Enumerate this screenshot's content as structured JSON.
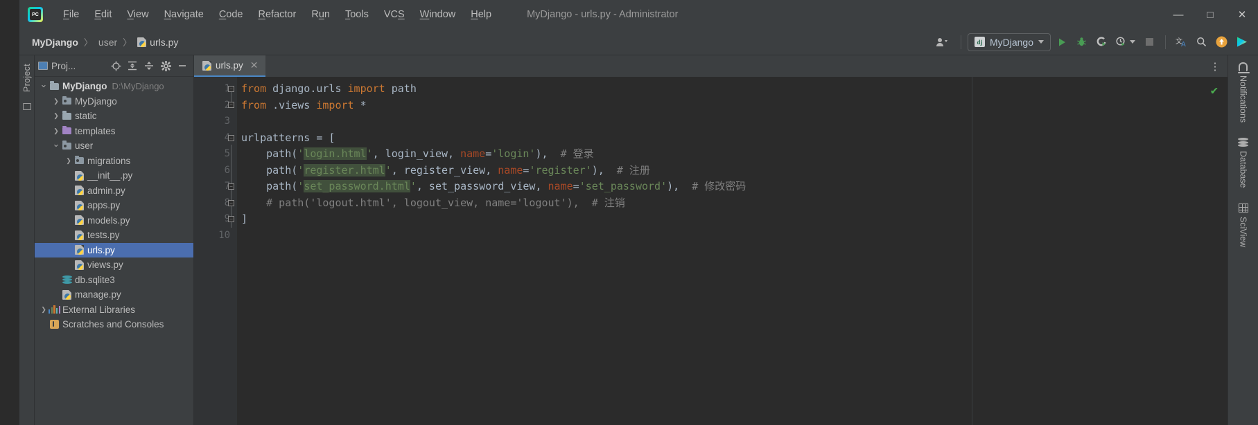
{
  "window": {
    "title": "MyDjango - urls.py - Administrator",
    "app_icon": "pycharm-logo-icon",
    "controls": {
      "minimize": "—",
      "maximize": "□",
      "close": "✕"
    }
  },
  "menubar": {
    "items": [
      {
        "label": "File",
        "mnemonic": "F"
      },
      {
        "label": "Edit",
        "mnemonic": "E"
      },
      {
        "label": "View",
        "mnemonic": "V"
      },
      {
        "label": "Navigate",
        "mnemonic": "N"
      },
      {
        "label": "Code",
        "mnemonic": "C"
      },
      {
        "label": "Refactor",
        "mnemonic": "R"
      },
      {
        "label": "Run",
        "mnemonic": "u"
      },
      {
        "label": "Tools",
        "mnemonic": "T"
      },
      {
        "label": "VCS",
        "mnemonic": "S"
      },
      {
        "label": "Window",
        "mnemonic": "W"
      },
      {
        "label": "Help",
        "mnemonic": "H"
      }
    ]
  },
  "navbar": {
    "breadcrumbs": [
      {
        "label": "MyDjango",
        "icon": ""
      },
      {
        "label": "user",
        "icon": ""
      },
      {
        "label": "urls.py",
        "icon": "python-file-icon"
      }
    ],
    "separator": "〉",
    "account_icon": "user-account-icon",
    "run_config": {
      "label": "MyDjango",
      "icon": "django-icon"
    },
    "actions": [
      {
        "name": "run-button",
        "icon": "play-icon",
        "color": "#499c54"
      },
      {
        "name": "debug-button",
        "icon": "bug-icon",
        "color": "#499c54"
      },
      {
        "name": "run-coverage-button",
        "icon": "coverage-icon",
        "color": "#b0b0b0"
      },
      {
        "name": "profile-button",
        "icon": "profile-icon",
        "color": "#b0b0b0"
      },
      {
        "name": "stop-button",
        "icon": "stop-square-icon",
        "color": "#6e6e6e"
      },
      {
        "name": "translate-button",
        "icon": "translate-icon",
        "color": "#b0b0b0"
      },
      {
        "name": "search-everywhere-button",
        "icon": "search-icon",
        "color": "#b0b0b0"
      },
      {
        "name": "update-button",
        "icon": "update-arrow-icon",
        "color": "#e8a33d"
      },
      {
        "name": "ide-assistant-button",
        "icon": "colorful-play-icon",
        "color": "#4a88c7"
      }
    ]
  },
  "left_strip": {
    "label": "Project",
    "structure_label": ""
  },
  "project_panel": {
    "title": "Proj...",
    "header_buttons": [
      {
        "name": "select-opened-file-button",
        "icon": "locate-target-icon"
      },
      {
        "name": "expand-all-button",
        "icon": "expand-all-icon"
      },
      {
        "name": "collapse-all-button",
        "icon": "collapse-all-icon"
      },
      {
        "name": "settings-button",
        "icon": "gear-icon"
      },
      {
        "name": "hide-button",
        "icon": "minimize-icon"
      }
    ],
    "tree": [
      {
        "label": "MyDjango",
        "path": "D:\\MyDjango",
        "icon": "folder-icon",
        "indent": 0,
        "arrow": "down",
        "bold": true,
        "selected": false
      },
      {
        "label": "MyDjango",
        "path": "",
        "icon": "source-folder-icon",
        "indent": 1,
        "arrow": "right",
        "bold": false,
        "selected": false
      },
      {
        "label": "static",
        "path": "",
        "icon": "folder-icon",
        "indent": 1,
        "arrow": "right",
        "bold": false,
        "selected": false
      },
      {
        "label": "templates",
        "path": "",
        "icon": "templates-folder-icon",
        "indent": 1,
        "arrow": "right",
        "bold": false,
        "selected": false
      },
      {
        "label": "user",
        "path": "",
        "icon": "source-folder-icon",
        "indent": 1,
        "arrow": "down",
        "bold": false,
        "selected": false
      },
      {
        "label": "migrations",
        "path": "",
        "icon": "source-folder-icon",
        "indent": 2,
        "arrow": "right",
        "bold": false,
        "selected": false
      },
      {
        "label": "__init__.py",
        "path": "",
        "icon": "python-file-icon",
        "indent": 2,
        "arrow": "none",
        "bold": false,
        "selected": false
      },
      {
        "label": "admin.py",
        "path": "",
        "icon": "python-file-icon",
        "indent": 2,
        "arrow": "none",
        "bold": false,
        "selected": false
      },
      {
        "label": "apps.py",
        "path": "",
        "icon": "python-file-icon",
        "indent": 2,
        "arrow": "none",
        "bold": false,
        "selected": false
      },
      {
        "label": "models.py",
        "path": "",
        "icon": "python-file-icon",
        "indent": 2,
        "arrow": "none",
        "bold": false,
        "selected": false
      },
      {
        "label": "tests.py",
        "path": "",
        "icon": "python-file-icon",
        "indent": 2,
        "arrow": "none",
        "bold": false,
        "selected": false
      },
      {
        "label": "urls.py",
        "path": "",
        "icon": "python-file-icon",
        "indent": 2,
        "arrow": "none",
        "bold": false,
        "selected": true
      },
      {
        "label": "views.py",
        "path": "",
        "icon": "python-file-icon",
        "indent": 2,
        "arrow": "none",
        "bold": false,
        "selected": false
      },
      {
        "label": "db.sqlite3",
        "path": "",
        "icon": "database-file-icon",
        "indent": 1,
        "arrow": "none",
        "bold": false,
        "selected": false
      },
      {
        "label": "manage.py",
        "path": "",
        "icon": "python-file-icon",
        "indent": 1,
        "arrow": "none",
        "bold": false,
        "selected": false
      },
      {
        "label": "External Libraries",
        "path": "",
        "icon": "libraries-icon",
        "indent": 0,
        "arrow": "right",
        "bold": false,
        "selected": false
      },
      {
        "label": "Scratches and Consoles",
        "path": "",
        "icon": "scratches-icon",
        "indent": 0,
        "arrow": "none",
        "bold": false,
        "selected": false
      }
    ]
  },
  "editor": {
    "tabs": [
      {
        "label": "urls.py",
        "icon": "python-file-icon",
        "close": "✕",
        "active": true
      }
    ],
    "options_icon": "kebab-menu-icon",
    "inspection_status": "✔",
    "line_numbers": [
      "1",
      "2",
      "3",
      "4",
      "5",
      "6",
      "7",
      "8",
      "9",
      "10"
    ],
    "code_lines": [
      {
        "n": 1,
        "tokens": [
          {
            "t": "from",
            "c": "kw"
          },
          {
            "t": " django.urls ",
            "c": "id"
          },
          {
            "t": "import",
            "c": "kw"
          },
          {
            "t": " path",
            "c": "id"
          }
        ]
      },
      {
        "n": 2,
        "tokens": [
          {
            "t": "from",
            "c": "kw"
          },
          {
            "t": " .views ",
            "c": "id"
          },
          {
            "t": "import",
            "c": "kw"
          },
          {
            "t": " *",
            "c": "id"
          }
        ]
      },
      {
        "n": 3,
        "tokens": []
      },
      {
        "n": 4,
        "tokens": [
          {
            "t": "urlpatterns = [",
            "c": "id"
          }
        ]
      },
      {
        "n": 5,
        "tokens": [
          {
            "t": "    path(",
            "c": "id"
          },
          {
            "t": "'",
            "c": "str"
          },
          {
            "t": "login.html",
            "c": "str-hl"
          },
          {
            "t": "'",
            "c": "str"
          },
          {
            "t": ", login_view, ",
            "c": "id"
          },
          {
            "t": "name",
            "c": "kwarg"
          },
          {
            "t": "=",
            "c": "id"
          },
          {
            "t": "'login'",
            "c": "str"
          },
          {
            "t": "),  ",
            "c": "id"
          },
          {
            "t": "# 登录",
            "c": "cmt"
          }
        ]
      },
      {
        "n": 6,
        "tokens": [
          {
            "t": "    path(",
            "c": "id"
          },
          {
            "t": "'",
            "c": "str"
          },
          {
            "t": "register.html",
            "c": "str-hl"
          },
          {
            "t": "'",
            "c": "str"
          },
          {
            "t": ", register_view, ",
            "c": "id"
          },
          {
            "t": "name",
            "c": "kwarg"
          },
          {
            "t": "=",
            "c": "id"
          },
          {
            "t": "'register'",
            "c": "str"
          },
          {
            "t": "),  ",
            "c": "id"
          },
          {
            "t": "# 注册",
            "c": "cmt"
          }
        ]
      },
      {
        "n": 7,
        "tokens": [
          {
            "t": "    path(",
            "c": "id"
          },
          {
            "t": "'",
            "c": "str"
          },
          {
            "t": "set_password.html",
            "c": "str-hl"
          },
          {
            "t": "'",
            "c": "str"
          },
          {
            "t": ", set_password_view, ",
            "c": "id"
          },
          {
            "t": "name",
            "c": "kwarg"
          },
          {
            "t": "=",
            "c": "id"
          },
          {
            "t": "'set_password'",
            "c": "str"
          },
          {
            "t": "),  ",
            "c": "id"
          },
          {
            "t": "# 修改密码",
            "c": "cmt"
          }
        ]
      },
      {
        "n": 8,
        "tokens": [
          {
            "t": "    # path('logout.html', logout_view, name='logout'),  # 注销",
            "c": "cmt"
          }
        ]
      },
      {
        "n": 9,
        "tokens": [
          {
            "t": "]",
            "c": "id"
          }
        ]
      },
      {
        "n": 10,
        "tokens": []
      }
    ],
    "colors": {
      "background": "#2b2b2b",
      "gutter": "#313335",
      "keyword": "#cc7832",
      "string": "#6a8759",
      "identifier": "#a9b7c6",
      "comment": "#808080",
      "kwarg": "#aa4926",
      "string_highlight_bg": "#41503c",
      "selection": "#4b6eaf"
    }
  },
  "right_strip": {
    "items": [
      {
        "label": "Notifications",
        "icon": "bell-icon"
      },
      {
        "label": "Database",
        "icon": "database-icon"
      },
      {
        "label": "SciView",
        "icon": "grid-icon"
      }
    ]
  }
}
